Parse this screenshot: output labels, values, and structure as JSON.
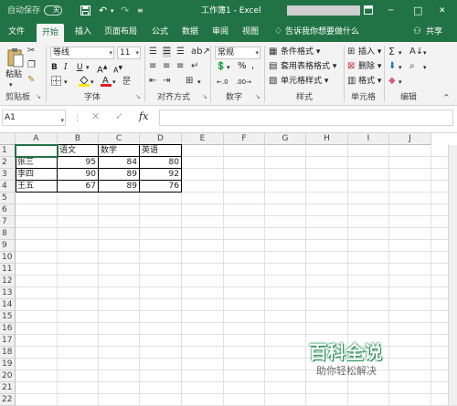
{
  "titlebar": {
    "autosave": "自动保存",
    "autosave_state": "关",
    "title": "工作簿1  -  Excel",
    "minimize": "─",
    "maximize": "□",
    "close": "✕"
  },
  "tabs": [
    "文件",
    "开始",
    "插入",
    "页面布局",
    "公式",
    "数据",
    "审阅",
    "视图"
  ],
  "tell_me": "告诉我你想要做什么",
  "share": "共享",
  "ribbon": {
    "paste": "粘贴",
    "font_name": "等线",
    "font_size": "11",
    "number_format": "常规",
    "conditional_format": "条件格式 ▾",
    "table_format": "套用表格格式 ▾",
    "cell_style": "单元格样式 ▾",
    "insert": "插入 ▾",
    "delete": "删除 ▾",
    "format": "格式 ▾",
    "group_labels": [
      "剪贴板",
      "字体",
      "对齐方式",
      "数字",
      "样式",
      "单元格",
      "编辑"
    ]
  },
  "formula": {
    "name_box": "A1",
    "fx": "fx",
    "value": ""
  },
  "sheet": {
    "columns": [
      "A",
      "B",
      "C",
      "D",
      "E",
      "F",
      "G",
      "H",
      "I",
      "J"
    ],
    "row_numbers": [
      "1",
      "2",
      "3",
      "4",
      "5",
      "6",
      "7",
      "8",
      "9",
      "10",
      "11",
      "12",
      "13",
      "14",
      "15",
      "16",
      "17",
      "18",
      "19",
      "20",
      "21",
      "22"
    ],
    "headers": [
      "语文",
      "数学",
      "英语"
    ],
    "rows": [
      {
        "name": "张三",
        "scores": [
          "95",
          "84",
          "80"
        ]
      },
      {
        "name": "李四",
        "scores": [
          "90",
          "89",
          "92"
        ]
      },
      {
        "name": "王五",
        "scores": [
          "67",
          "89",
          "76"
        ]
      }
    ]
  },
  "watermark": {
    "title": "百科全说",
    "subtitle": "助你轻松解决"
  },
  "colors": {
    "excel_green": "#217346",
    "font_color_red": "#e02020",
    "highlight_yellow": "#ffe600"
  }
}
